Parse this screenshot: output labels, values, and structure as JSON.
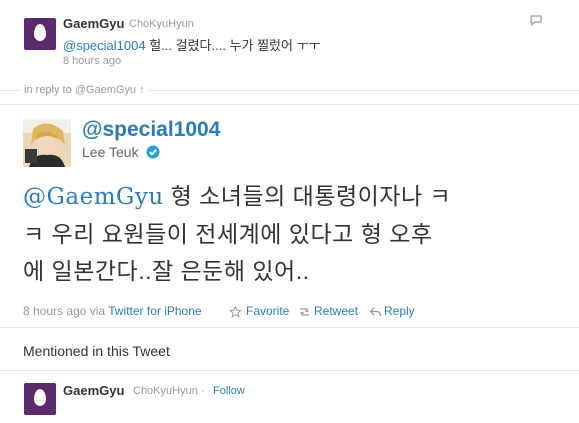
{
  "reply_tweet": {
    "screen_name": "GaemGyu",
    "full_name": "ChoKyuHyun",
    "mention": "@special1004",
    "text": " 헐... 걸렸다.... 누가 찔렀어 ㅜㅜ",
    "time": "8 hours ago",
    "icon": "speech-bubble-icon"
  },
  "in_reply_to": "in reply to @GaemGyu ↑",
  "main_tweet": {
    "screen_name": "@special1004",
    "name": "Lee Teuk",
    "verified_icon": "verified-badge-icon",
    "mention": "@GaemGyu",
    "line1_rest": " 형 소녀들의 대통령이자나 ㅋ",
    "line2": "ㅋ 우리 요원들이 전세계에 있다고 형 오후",
    "line3": "에 일본간다..잘 은둔해 있어..",
    "time": "8 hours ago",
    "via_prefix": "via",
    "via_client": "Twitter for iPhone",
    "actions": {
      "favorite": "Favorite",
      "retweet": "Retweet",
      "reply": "Reply"
    }
  },
  "mentioned": {
    "heading": "Mentioned in this Tweet",
    "screen_name": "GaemGyu",
    "full_name": "ChoKyuHyun",
    "separator": "·",
    "follow": "Follow"
  },
  "colors": {
    "link": "#2b7bb9",
    "muted": "#999999",
    "egg_avatar": "#5c2a6b"
  }
}
